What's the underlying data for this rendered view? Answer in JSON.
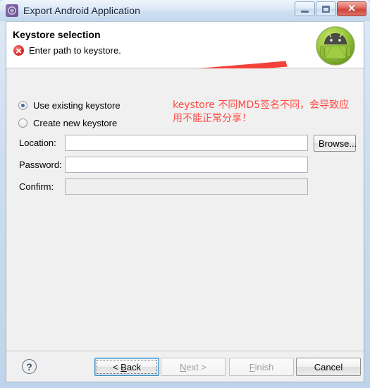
{
  "window": {
    "title": "Export Android Application",
    "icon": "eclipse-export-icon",
    "controls": {
      "minimize": "minimize-icon",
      "maximize": "restore-icon",
      "close": "✕"
    }
  },
  "header": {
    "title": "Keystore selection",
    "status_icon": "error-icon",
    "status_message": "Enter path to keystore.",
    "logo": "android-robot-logo"
  },
  "annotation": {
    "line1": "keystore 不同MD5签名不同，会导致应",
    "line2": "用不能正常分享！",
    "color": "#fd4a42",
    "arrow": "red-left-arrow"
  },
  "options": {
    "existing_label": "Use existing keystore",
    "existing_selected": true,
    "new_label": "Create new keystore",
    "new_selected": false
  },
  "fields": [
    {
      "label": "Location:",
      "value": "",
      "placeholder": "",
      "disabled": false
    },
    {
      "label": "Password:",
      "value": "",
      "placeholder": "",
      "disabled": false
    },
    {
      "label": "Confirm:",
      "value": "",
      "placeholder": "",
      "disabled": true
    }
  ],
  "browse": {
    "label": "Browse..."
  },
  "footer": {
    "help_icon": "?",
    "buttons": [
      {
        "label": "< Back",
        "disabled": false,
        "focused": true
      },
      {
        "label": "Next >",
        "disabled": true,
        "focused": false
      },
      {
        "label": "Finish",
        "disabled": true,
        "focused": false
      },
      {
        "label": "Cancel",
        "disabled": false,
        "focused": false
      }
    ]
  }
}
